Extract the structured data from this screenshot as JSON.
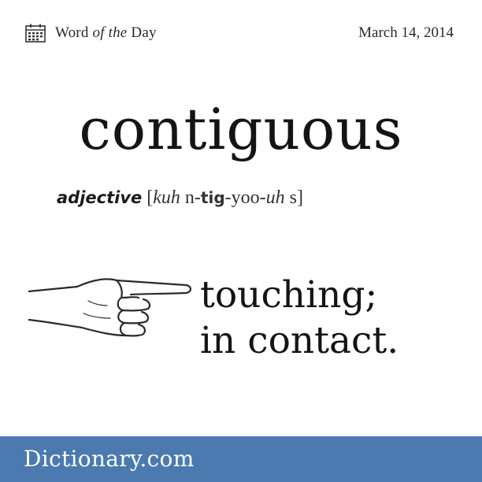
{
  "header": {
    "label_prefix": "Word ",
    "label_italic": "of the",
    "label_suffix": " Day",
    "date": "March 14, 2014",
    "icon": "calendar-icon"
  },
  "word": "contiguous",
  "part_of_speech": "adjective",
  "pronunciation": {
    "open": "[",
    "seg1": "kuh",
    "seg2": " n-",
    "seg3": "tig",
    "seg4": "-yoo-",
    "seg5": "uh",
    "seg6": " s",
    "close": "]"
  },
  "definition": {
    "line1": "touching;",
    "line2": "in contact."
  },
  "hand_icon": "pointing-hand-icon",
  "footer": {
    "brand": "Dictionary.com",
    "color": "#4a7ab0"
  }
}
